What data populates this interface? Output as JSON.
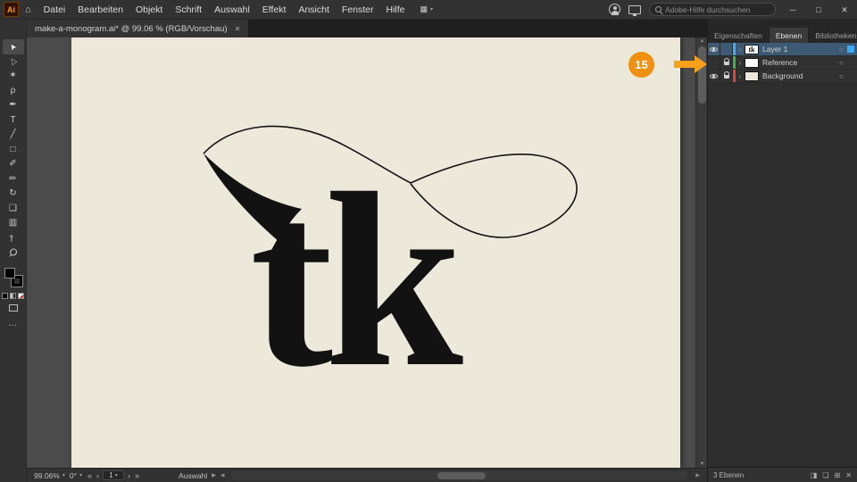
{
  "window": {
    "app_badge": "Ai",
    "home_glyph": "⌂",
    "minimize": "─",
    "maximize": "□",
    "close": "✕"
  },
  "menubar": {
    "items": [
      "Datei",
      "Bearbeiten",
      "Objekt",
      "Schrift",
      "Auswahl",
      "Effekt",
      "Ansicht",
      "Fenster",
      "Hilfe"
    ],
    "workspace_glyph": "▦",
    "workspace_caret": "▾"
  },
  "topbar": {
    "search_placeholder": "Adobe-Hilfe durchsuchen"
  },
  "document_tab": {
    "title": "make-a-monogram.ai* @ 99.06 % (RGB/Vorschau)",
    "close_glyph": "✕"
  },
  "toolbar": {
    "tools": [
      {
        "name": "selection-tool",
        "glyph": "➤"
      },
      {
        "name": "direct-selection-tool",
        "glyph": "▷"
      },
      {
        "name": "magic-wand-tool",
        "glyph": "✶"
      },
      {
        "name": "lasso-tool",
        "glyph": "ρ"
      },
      {
        "name": "pen-tool",
        "glyph": "✒"
      },
      {
        "name": "type-tool",
        "glyph": "T"
      },
      {
        "name": "line-segment-tool",
        "glyph": "╱"
      },
      {
        "name": "rectangle-tool",
        "glyph": "□"
      },
      {
        "name": "paintbrush-tool",
        "glyph": "✐"
      },
      {
        "name": "pencil-tool",
        "glyph": "✏"
      },
      {
        "name": "rotate-tool",
        "glyph": "↻"
      },
      {
        "name": "scale-tool",
        "glyph": "❏"
      },
      {
        "name": "gradient-tool",
        "glyph": "▥"
      },
      {
        "name": "eyedropper-tool",
        "glyph": "⊸"
      },
      {
        "name": "zoom-tool",
        "glyph": "Ϙ"
      }
    ],
    "more_glyph": "…"
  },
  "canvas": {
    "monogram": "tk"
  },
  "layers_panel": {
    "tabs": [
      "Eigenschaften",
      "Ebenen",
      "Bibliotheken"
    ],
    "active_tab": "Ebenen",
    "menu_glyph": "≡",
    "chevron_glyph": "›",
    "target_glyph": "○",
    "layers": [
      {
        "name": "Layer 1",
        "visible": true,
        "locked": false,
        "selected": true,
        "color": "#3fa9f5",
        "thumb_bg": "#ffffff",
        "thumb_label": "tk"
      },
      {
        "name": "Reference",
        "visible": false,
        "locked": true,
        "selected": false,
        "color": "#3cb44a",
        "thumb_bg": "#ffffff",
        "thumb_label": ""
      },
      {
        "name": "Background",
        "visible": true,
        "locked": true,
        "selected": false,
        "color": "#e0443a",
        "thumb_bg": "#ece8da",
        "thumb_label": ""
      }
    ],
    "footer": {
      "count": "3 Ebenen",
      "icons": [
        {
          "name": "make-clipping-mask-icon",
          "glyph": "◨"
        },
        {
          "name": "new-sublayer-icon",
          "glyph": "❏"
        },
        {
          "name": "new-layer-icon",
          "glyph": "⊞"
        },
        {
          "name": "delete-layer-icon",
          "glyph": "✕"
        }
      ]
    }
  },
  "statusbar": {
    "zoom": "99.06%",
    "caret": "▾",
    "rotation": "0°",
    "nav_first": "«",
    "nav_prev": "‹",
    "artboard": "1",
    "nav_next": "›",
    "nav_last": "»",
    "status": "Auswahl",
    "flyout": "▶",
    "scroll_left": "◀",
    "scroll_right": "▶",
    "scroll_up": "▲",
    "scroll_down": "▼"
  },
  "annotations": {
    "step": "15"
  },
  "colors": {
    "accent_orange": "#ef9011",
    "arrow_orange": "#f9a01b",
    "artboard_cream": "#ece8da",
    "selection_blue": "#3d5a74"
  }
}
